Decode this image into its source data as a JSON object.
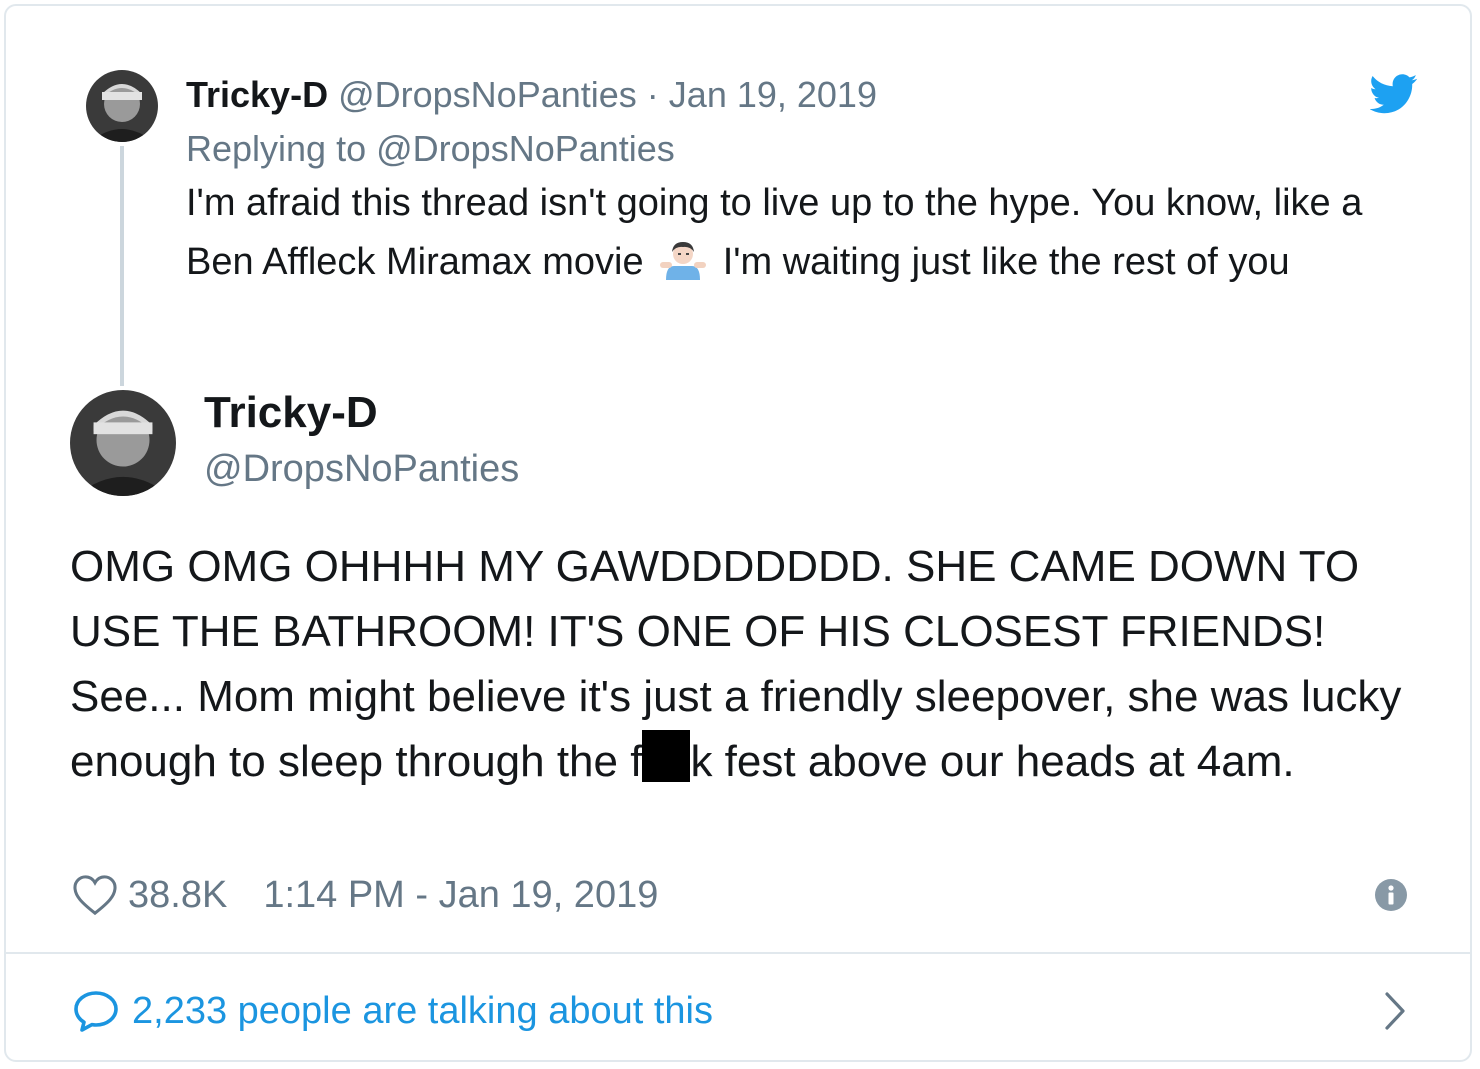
{
  "parent_tweet": {
    "display_name": "Tricky-D",
    "handle": "@DropsNoPanties",
    "separator": "·",
    "date": "Jan 19, 2019",
    "replying_prefix": "Replying to",
    "replying_handle": "@DropsNoPanties",
    "text_part1": "I'm afraid this thread isn't going to live up to the hype. You know, like a Ben Affleck Miramax movie",
    "text_part2": "I'm waiting just like the rest of you",
    "emoji": "man-shrugging-icon"
  },
  "main_tweet": {
    "display_name": "Tricky-D",
    "handle": "@DropsNoPanties",
    "text_part1": "OMG OMG OHHHH MY GAWDDDDDDD. SHE CAME DOWN TO USE THE BATHROOM! IT'S ONE OF HIS CLOSEST FRIENDS! See... Mom might believe it's just a friendly sleepover, she was lucky enough to sleep through the f",
    "text_part2": "k fest above our heads at 4am.",
    "likes": "38.8K",
    "timestamp": "1:14 PM - Jan 19, 2019"
  },
  "footer": {
    "talking_text": "2,233 people are talking about this"
  },
  "colors": {
    "twitter_blue": "#1da1f2",
    "link_blue": "#1b95e0",
    "secondary_text": "#657786",
    "border": "#e1e8ed"
  }
}
